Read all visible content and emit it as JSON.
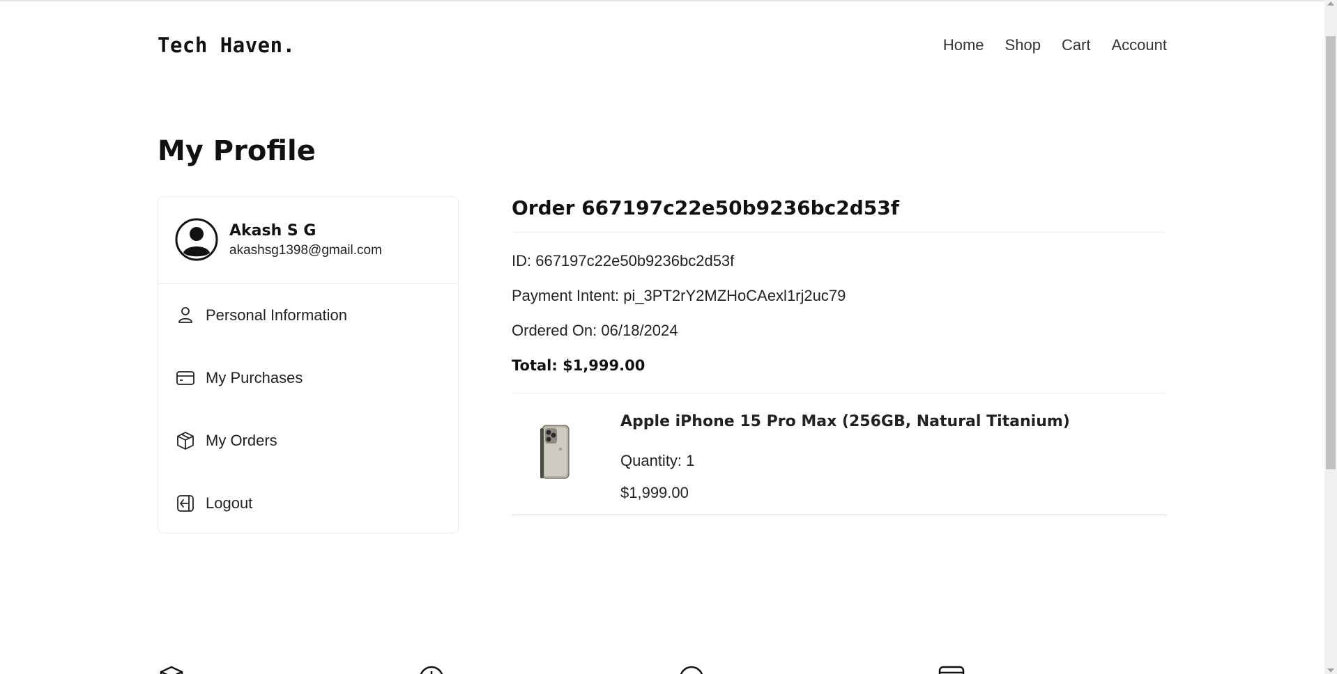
{
  "brand": {
    "logo": "Tech Haven."
  },
  "nav": {
    "items": [
      "Home",
      "Shop",
      "Cart",
      "Account"
    ]
  },
  "page": {
    "title": "My Profile"
  },
  "sidebar": {
    "user": {
      "name": "Akash S G",
      "email": "akashsg1398@gmail.com",
      "avatar_icon": "user-circle-icon"
    },
    "items": [
      {
        "label": "Personal Information",
        "icon": "user-icon"
      },
      {
        "label": "My Purchases",
        "icon": "credit-card-icon"
      },
      {
        "label": "My Orders",
        "icon": "package-icon"
      },
      {
        "label": "Logout",
        "icon": "logout-icon"
      }
    ]
  },
  "order": {
    "title": "Order 667197c22e50b9236bc2d53f",
    "id_line": "ID: 667197c22e50b9236bc2d53f",
    "payment_line": "Payment Intent: pi_3PT2rY2MZHoCAexl1rj2uc79",
    "date_line": "Ordered On: 06/18/2024",
    "total_line": "Total: $1,999.00",
    "items": [
      {
        "name": "Apple iPhone 15 Pro Max (256GB, Natural Titanium)",
        "quantity": "Quantity: 1",
        "price": "$1,999.00",
        "image_icon": "iphone-image"
      }
    ]
  },
  "colors": {
    "text": "#1a1a1a",
    "border": "#ececec",
    "background": "#ffffff"
  }
}
